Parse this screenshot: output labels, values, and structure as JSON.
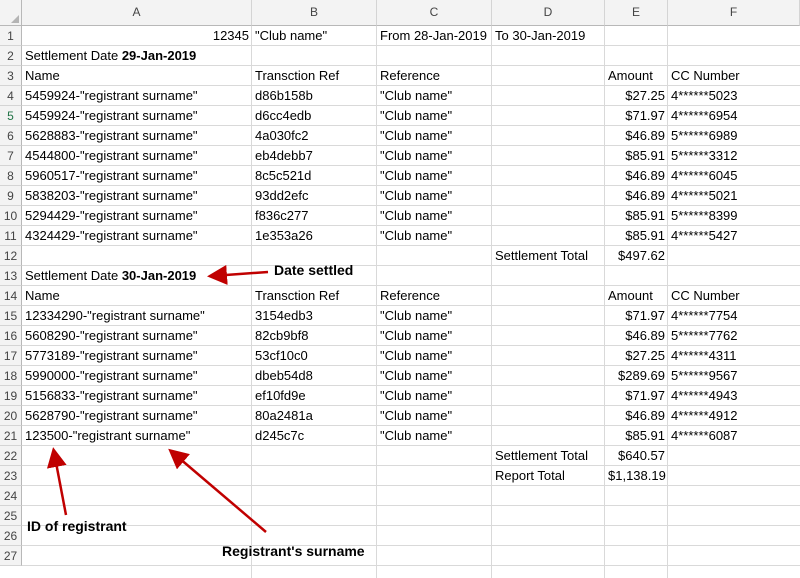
{
  "columns": [
    "A",
    "B",
    "C",
    "D",
    "E",
    "F"
  ],
  "rows": [
    "1",
    "2",
    "3",
    "4",
    "5",
    "6",
    "7",
    "8",
    "9",
    "10",
    "11",
    "12",
    "13",
    "14",
    "15",
    "16",
    "17",
    "18",
    "19",
    "20",
    "21",
    "22",
    "23",
    "24",
    "25",
    "26",
    "27"
  ],
  "selected_row": "5",
  "row1": {
    "a": "12345",
    "b": "\"Club name\"",
    "c": "From 28-Jan-2019",
    "d": "To 30-Jan-2019"
  },
  "sections": [
    {
      "date_label": "Settlement Date ",
      "date_value": "29-Jan-2019",
      "headers": {
        "name": "Name",
        "ref": "Transction Ref",
        "reference": "Reference",
        "amount": "Amount",
        "cc": "CC Number"
      },
      "rows": [
        {
          "name": "5459924-\"registrant surname\"",
          "ref": "d86b158b",
          "reference": "\"Club name\"",
          "amount": "$27.25",
          "cc": "4******5023"
        },
        {
          "name": "5459924-\"registrant surname\"",
          "ref": "d6cc4edb",
          "reference": "\"Club name\"",
          "amount": "$71.97",
          "cc": "4******6954"
        },
        {
          "name": "5628883-\"registrant surname\"",
          "ref": "4a030fc2",
          "reference": "\"Club name\"",
          "amount": "$46.89",
          "cc": "5******6989"
        },
        {
          "name": "4544800-\"registrant surname\"",
          "ref": "eb4debb7",
          "reference": "\"Club name\"",
          "amount": "$85.91",
          "cc": "5******3312"
        },
        {
          "name": "5960517-\"registrant surname\"",
          "ref": "8c5c521d",
          "reference": "\"Club name\"",
          "amount": "$46.89",
          "cc": "4******6045"
        },
        {
          "name": "5838203-\"registrant surname\"",
          "ref": "93dd2efc",
          "reference": "\"Club name\"",
          "amount": "$46.89",
          "cc": "4******5021"
        },
        {
          "name": "5294429-\"registrant surname\"",
          "ref": "f836c277",
          "reference": "\"Club name\"",
          "amount": "$85.91",
          "cc": "5******8399"
        },
        {
          "name": "4324429-\"registrant surname\"",
          "ref": "1e353a26",
          "reference": "\"Club name\"",
          "amount": "$85.91",
          "cc": "4******5427"
        }
      ],
      "total_label": "Settlement Total",
      "total_value": "$497.62"
    },
    {
      "date_label": "Settlement Date ",
      "date_value": "30-Jan-2019",
      "headers": {
        "name": "Name",
        "ref": "Transction Ref",
        "reference": "Reference",
        "amount": "Amount",
        "cc": "CC Number"
      },
      "rows": [
        {
          "name": "12334290-\"registrant surname\"",
          "ref": "3154edb3",
          "reference": "\"Club name\"",
          "amount": "$71.97",
          "cc": "4******7754"
        },
        {
          "name": "5608290-\"registrant surname\"",
          "ref": "82cb9bf8",
          "reference": "\"Club name\"",
          "amount": "$46.89",
          "cc": "5******7762"
        },
        {
          "name": "5773189-\"registrant surname\"",
          "ref": "53cf10c0",
          "reference": "\"Club name\"",
          "amount": "$27.25",
          "cc": "4******4311"
        },
        {
          "name": "5990000-\"registrant surname\"",
          "ref": "dbeb54d8",
          "reference": "\"Club name\"",
          "amount": "$289.69",
          "cc": "5******9567"
        },
        {
          "name": "5156833-\"registrant surname\"",
          "ref": "ef10fd9e",
          "reference": "\"Club name\"",
          "amount": "$71.97",
          "cc": "4******4943"
        },
        {
          "name": "5628790-\"registrant surname\"",
          "ref": "80a2481a",
          "reference": "\"Club name\"",
          "amount": "$46.89",
          "cc": "4******4912"
        },
        {
          "name": "123500-\"registrant surname\"",
          "ref": "d245c7c",
          "reference": "\"Club name\"",
          "amount": "$85.91",
          "cc": "4******6087"
        }
      ],
      "total_label": "Settlement Total",
      "total_value": "$640.57"
    }
  ],
  "report_total_label": "Report Total",
  "report_total_value": "$1,138.19",
  "annotations": {
    "date_settled": "Date settled",
    "id_of_registrant": "ID of registrant",
    "registrant_surname": "Registrant's surname"
  },
  "colors": {
    "arrow": "#c00000",
    "header_bg": "#f3f3f3",
    "gridline": "#d9d9d9",
    "selected_row": "#217346"
  }
}
